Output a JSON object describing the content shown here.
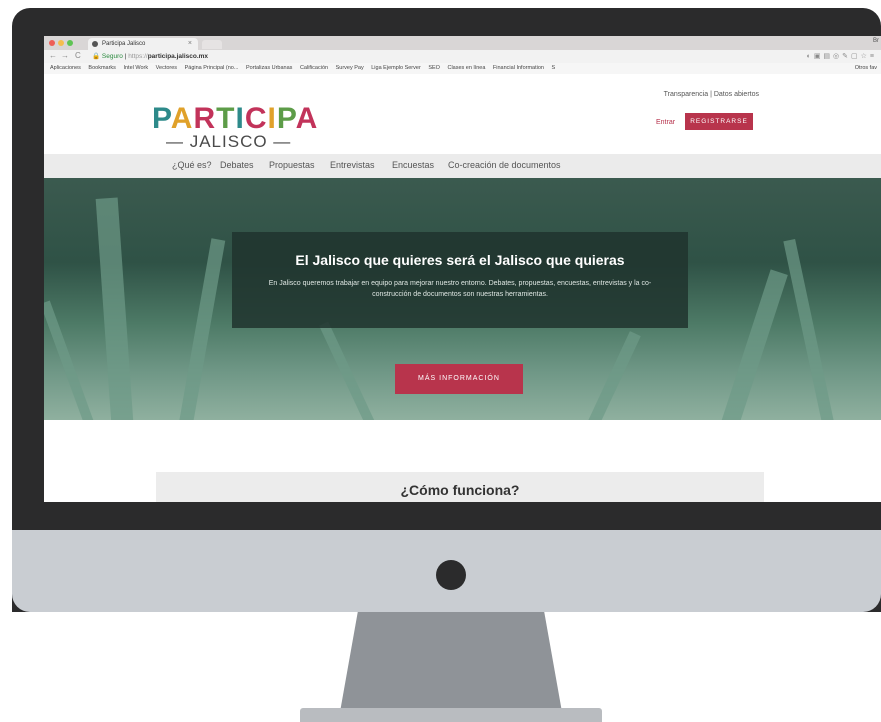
{
  "browser": {
    "tab_title": "Participa Jalisco",
    "tab_close": "×",
    "user_tab": "Br",
    "nav_back": "←",
    "nav_forward": "→",
    "nav_reload": "C",
    "url_secure": "Seguro",
    "url_proto": "https://",
    "url_host": "participa.jalisco.mx",
    "bookmarks": [
      "Aplicaciones",
      "Bookmarks",
      "Intel Work",
      "Vectores",
      "Página Principal (no...",
      "Portalizas Urbanas",
      "Calificación",
      "Survey Pay",
      "Liga Ejemplo Server",
      "SEO",
      "Clases en línea",
      "Financial Information",
      "S"
    ],
    "bookmark_right": "Otros fav"
  },
  "header": {
    "transparency": "Transparencia",
    "separator": "|",
    "open_data": "Datos abiertos",
    "logo_main": "PARTICIPA",
    "logo_sub": "— JALISCO —",
    "login": "Entrar",
    "register": "REGISTRARSE"
  },
  "menu": {
    "items": [
      "¿Qué es?",
      "Debates",
      "Propuestas",
      "Entrevistas",
      "Encuestas",
      "Co-creación de documentos"
    ]
  },
  "hero": {
    "title": "El Jalisco que quieres será el Jalisco que quieras",
    "text": "En Jalisco queremos trabajar en equipo para mejorar nuestro entorno. Debates, propuestas, encuestas, entrevistas y la co-construcción de documentos son nuestras herramientas.",
    "button": "MÁS INFORMACIÓN"
  },
  "how": {
    "title": "¿Cómo funciona?"
  },
  "colors": {
    "accent": "#b8344c",
    "monitor": "#2b2b2c",
    "hero_overlay": "#20342e"
  }
}
